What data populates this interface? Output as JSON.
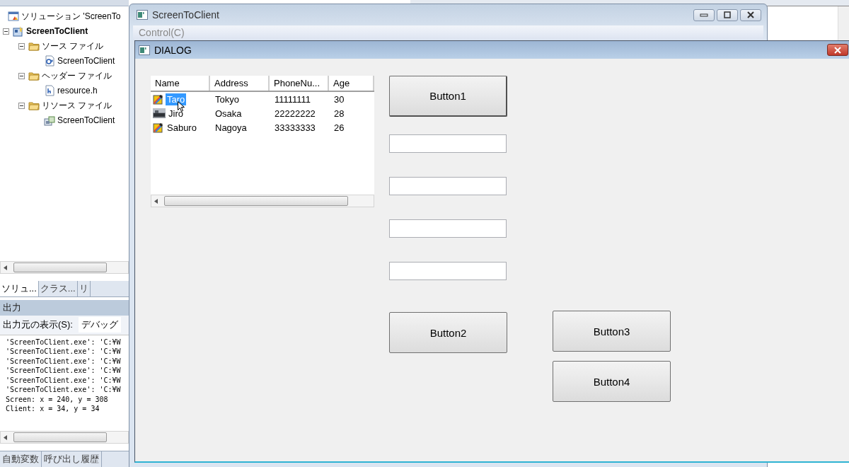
{
  "ide": {
    "solution_tree": [
      {
        "label": "ソリューション 'ScreenTo",
        "kind": "solution",
        "children": [
          {
            "label": "ScreenToClient",
            "kind": "project",
            "expanded": true,
            "children": [
              {
                "label": "ソース ファイル",
                "kind": "folder",
                "expanded": true,
                "children": [
                  {
                    "label": "ScreenToClient",
                    "kind": "cpp"
                  }
                ]
              },
              {
                "label": "ヘッダー ファイル",
                "kind": "folder",
                "expanded": true,
                "children": [
                  {
                    "label": "resource.h",
                    "kind": "header"
                  }
                ]
              },
              {
                "label": "リソース ファイル",
                "kind": "folder",
                "expanded": true,
                "children": [
                  {
                    "label": "ScreenToClient",
                    "kind": "resource"
                  }
                ]
              }
            ]
          }
        ]
      }
    ],
    "panel_tabs": [
      {
        "label": "ソリュ...",
        "selected": true
      },
      {
        "label": "クラス...",
        "selected": false
      },
      {
        "label": "リ",
        "selected": false
      }
    ],
    "output": {
      "title": "出力",
      "source_label": "出力元の表示(S):",
      "source_value": "デバッグ",
      "lines": [
        "'ScreenToClient.exe': 'C:¥W",
        "'ScreenToClient.exe': 'C:¥W",
        "'ScreenToClient.exe': 'C:¥W",
        "'ScreenToClient.exe': 'C:¥W",
        "'ScreenToClient.exe': 'C:¥W",
        "'ScreenToClient.exe': 'C:¥W",
        "Screen: x = 240, y = 308",
        "Client: x = 34, y = 34"
      ]
    },
    "bottom_tabs": [
      {
        "label": "自動変数"
      },
      {
        "label": "呼び出し履歴"
      }
    ]
  },
  "app_window": {
    "title": "ScreenToClient",
    "menu": [
      "Control(C)"
    ]
  },
  "dialog": {
    "title": "DIALOG",
    "list": {
      "columns": [
        "Name",
        "Address",
        "PhoneNu...",
        "Age"
      ],
      "rows": [
        {
          "kind": "pencil",
          "cells": [
            "Taro",
            "Tokyo",
            "11111111",
            "30"
          ],
          "selected": true
        },
        {
          "kind": "photo",
          "cells": [
            "Jiro",
            "Osaka",
            "22222222",
            "28"
          ],
          "selected": false
        },
        {
          "kind": "pencil",
          "cells": [
            "Saburo",
            "Nagoya",
            "33333333",
            "26"
          ],
          "selected": false
        }
      ]
    },
    "text_fields": [
      {
        "kind": "edit"
      },
      {
        "kind": "edit"
      },
      {
        "kind": "edit"
      },
      {
        "kind": "edit"
      }
    ],
    "buttons": [
      {
        "label": "Button1",
        "default": true
      },
      {
        "label": "Button2",
        "default": false
      },
      {
        "label": "Button3",
        "default": false
      },
      {
        "label": "Button4",
        "default": false
      }
    ]
  }
}
